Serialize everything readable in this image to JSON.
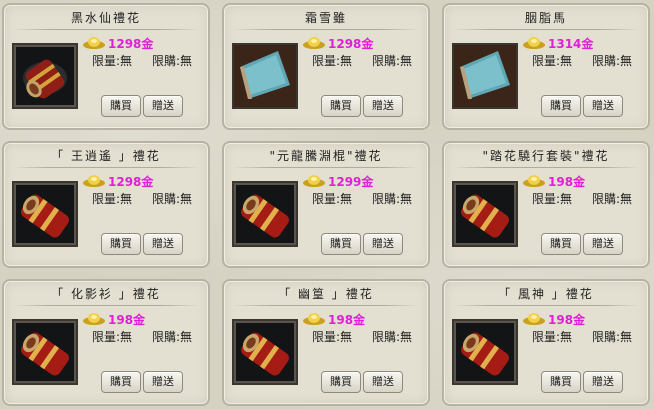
{
  "shop": {
    "items": [
      {
        "title": "黑水仙禮花",
        "price": "1298金",
        "limit_qty": "限量:無",
        "limit_buy": "限購:無",
        "buy": "購買",
        "gift": "贈送",
        "thumb": "firework-scroll-icon"
      },
      {
        "title": "霜雪雖",
        "price": "1298金",
        "limit_qty": "限量:無",
        "limit_buy": "限購:無",
        "buy": "購買",
        "gift": "贈送",
        "thumb": "paper-scroll-icon"
      },
      {
        "title": "胭脂馬",
        "price": "1314金",
        "limit_qty": "限量:無",
        "limit_buy": "限購:無",
        "buy": "購買",
        "gift": "贈送",
        "thumb": "paper-scroll-icon"
      },
      {
        "title": "「 王逍遙 」禮花",
        "price": "1298金",
        "limit_qty": "限量:無",
        "limit_buy": "限購:無",
        "buy": "購買",
        "gift": "贈送",
        "thumb": "firework-scroll-icon"
      },
      {
        "title": "\"元龍騰淵棍\"禮花",
        "price": "1299金",
        "limit_qty": "限量:無",
        "limit_buy": "限購:無",
        "buy": "購買",
        "gift": "贈送",
        "thumb": "firework-scroll-icon"
      },
      {
        "title": "\"踏花驍行套裝\"禮花",
        "price": "198金",
        "limit_qty": "限量:無",
        "limit_buy": "限購:無",
        "buy": "購買",
        "gift": "贈送",
        "thumb": "firework-scroll-icon"
      },
      {
        "title": "「 化影衫 」禮花",
        "price": "198金",
        "limit_qty": "限量:無",
        "limit_buy": "限購:無",
        "buy": "購買",
        "gift": "贈送",
        "thumb": "firework-scroll-icon"
      },
      {
        "title": "「 幽篁 」禮花",
        "price": "198金",
        "limit_qty": "限量:無",
        "limit_buy": "限購:無",
        "buy": "購買",
        "gift": "贈送",
        "thumb": "firework-scroll-icon"
      },
      {
        "title": "「 風神 」禮花",
        "price": "198金",
        "limit_qty": "限量:無",
        "limit_buy": "限購:無",
        "buy": "購買",
        "gift": "贈送",
        "thumb": "firework-scroll-icon"
      }
    ]
  },
  "colors": {
    "price": "#e020d8",
    "card_bg": "#e3dfd1",
    "border": "#b7b2a3"
  }
}
